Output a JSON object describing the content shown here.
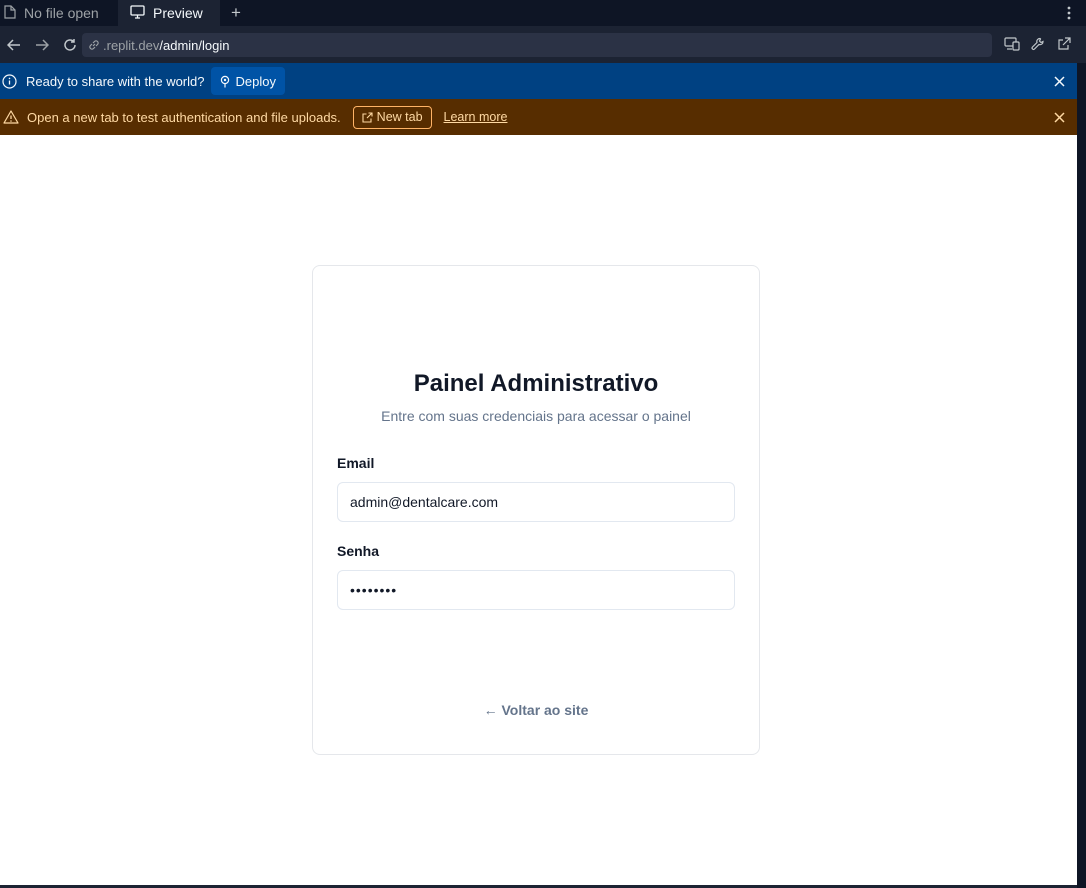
{
  "tabs": {
    "inactive_label": "No file open",
    "active_label": "Preview",
    "add_label": "+"
  },
  "urlbar": {
    "host": ".replit.dev",
    "path": "/admin/login"
  },
  "info_banner": {
    "text": "Ready to share with the world?",
    "deploy_label": "Deploy"
  },
  "warn_banner": {
    "text": "Open a new tab to test authentication and file uploads.",
    "new_tab_label": "New tab",
    "learn_more_label": "Learn more"
  },
  "login": {
    "title": "Painel Administrativo",
    "subtitle": "Entre com suas credenciais para acessar o painel",
    "email_label": "Email",
    "email_value": "admin@dentalcare.com",
    "password_label": "Senha",
    "password_value": "••••••••",
    "back_link": "← Voltar ao site"
  },
  "colors": {
    "info_banner_bg": "#004182",
    "warn_banner_bg": "#572d00",
    "deploy_button_bg": "#0053a6"
  }
}
